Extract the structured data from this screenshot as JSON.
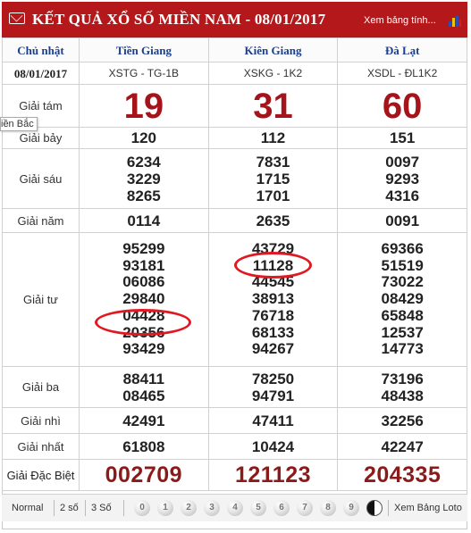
{
  "header": {
    "title": "KẾT QUẢ XỔ SỐ MIỀN NAM - 08/01/2017",
    "more_link": "Xem bảng tính...",
    "bar_colors": [
      "#2a4fb0",
      "#f2c200",
      "#2a4fb0",
      "#e01822"
    ]
  },
  "tooltip": "iền Bắc",
  "columns": {
    "day": "Chủ nhật",
    "date": "08/01/2017",
    "provinces": [
      {
        "name": "Tiền Giang",
        "code": "XSTG - TG-1B"
      },
      {
        "name": "Kiên Giang",
        "code": "XSKG - 1K2"
      },
      {
        "name": "Đà Lạt",
        "code": "XSDL - ĐL1K2"
      }
    ]
  },
  "prizes": {
    "g8": {
      "label": "Giải tám",
      "values": [
        "19",
        "31",
        "60"
      ]
    },
    "g7": {
      "label": "Giải bảy",
      "values": [
        "120",
        "112",
        "151"
      ]
    },
    "g6": {
      "label": "Giải sáu",
      "values": [
        [
          "6234",
          "3229",
          "8265"
        ],
        [
          "7831",
          "1715",
          "1701"
        ],
        [
          "0097",
          "9293",
          "4316"
        ]
      ]
    },
    "g5": {
      "label": "Giải năm",
      "values": [
        "0114",
        "2635",
        "0091"
      ]
    },
    "g4": {
      "label": "Giải tư",
      "values": [
        [
          "95299",
          "93181",
          "06086",
          "29840",
          "04428",
          "20356",
          "93429"
        ],
        [
          "43729",
          "11128",
          "44545",
          "38913",
          "76718",
          "68133",
          "94267"
        ],
        [
          "69366",
          "51519",
          "73022",
          "08429",
          "65848",
          "12537",
          "14773"
        ]
      ]
    },
    "g3": {
      "label": "Giải ba",
      "values": [
        [
          "88411",
          "08465"
        ],
        [
          "78250",
          "94791"
        ],
        [
          "73196",
          "48438"
        ]
      ]
    },
    "g2": {
      "label": "Giải nhì",
      "values": [
        "42491",
        "47411",
        "32256"
      ]
    },
    "g1": {
      "label": "Giải nhất",
      "values": [
        "61808",
        "10424",
        "42247"
      ]
    },
    "db": {
      "label": "Giải Đặc Biệt",
      "values": [
        "002709",
        "121123",
        "204335"
      ]
    }
  },
  "footer": {
    "options": [
      "Normal",
      "2 số",
      "3 Số"
    ],
    "balls": [
      "0",
      "1",
      "2",
      "3",
      "4",
      "5",
      "6",
      "7",
      "8",
      "9"
    ],
    "loto_link": "Xem Bảng Loto"
  },
  "annotation_color": "#e01822"
}
